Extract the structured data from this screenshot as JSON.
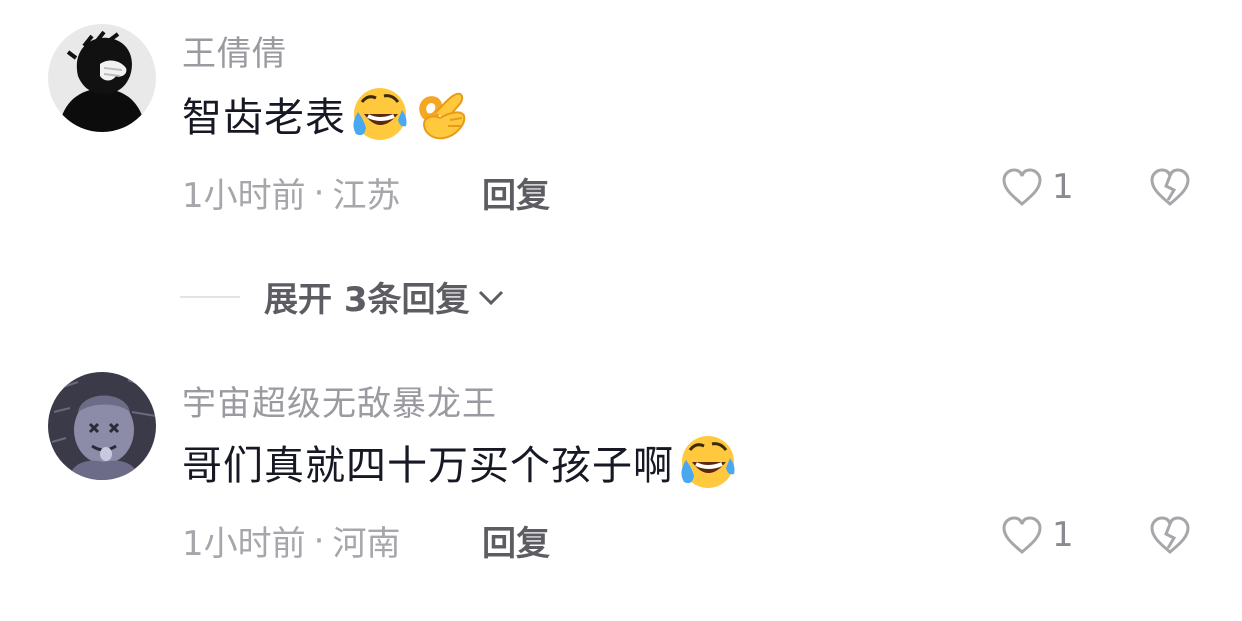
{
  "comments": [
    {
      "username": "王倩倩",
      "text": "智齿老表",
      "emojis": [
        "laughing-crying-emoji",
        "ok-hand-emoji"
      ],
      "time": "1小时前",
      "location": "江苏",
      "reply_label": "回复",
      "likes": "1"
    },
    {
      "username": "宇宙超级无敌暴龙王",
      "text": "哥们真就四十万买个孩子啊",
      "emojis": [
        "laughing-crying-emoji"
      ],
      "time": "1小时前",
      "location": "河南",
      "reply_label": "回复",
      "likes": "1"
    }
  ],
  "expand_replies": {
    "label": "展开 3条回复"
  },
  "separator": "·",
  "colors": {
    "username": "#9a9aa0",
    "text": "#161823",
    "meta": "#a6a6ab",
    "action": "#5c5c62"
  }
}
